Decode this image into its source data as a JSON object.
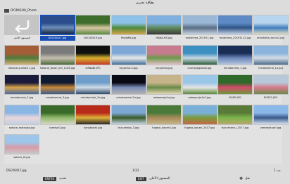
{
  "title": "بطاقة تخزين",
  "path": {
    "label": "DCIM\\100_Photo"
  },
  "up_item": {
    "label": "المستوى الأعلى"
  },
  "files": [
    {
      "label": "DSC00417.jpg",
      "colors": [
        "#2b4d8c",
        "#6e8fb8",
        "#1a2a44"
      ],
      "selected": true
    },
    {
      "label": "DSC00419.jpg",
      "colors": [
        "#3d6d2a",
        "#d8c6a4",
        "#5a8a40"
      ]
    },
    {
      "label": "fliedoffs.jpg",
      "colors": [
        "#8ec1e8",
        "#4f8a3a",
        "#d7a54c"
      ]
    },
    {
      "label": "HANA-HS.jpg",
      "colors": [
        "#7fb0e0",
        "#5f8a5a",
        "#3a3a3a"
      ]
    },
    {
      "label": "enoshima_201911.jpg",
      "colors": [
        "#9ab8d6",
        "#5a6e86",
        "#c9d6e3"
      ]
    },
    {
      "label": "enoshima_20191112.jpg",
      "colors": [
        "#5d89c4",
        "#2f5486",
        "#c4d3e4"
      ]
    },
    {
      "label": "enoshima_touna1.jpg",
      "colors": [
        "#b8d4ee",
        "#3f7fbf",
        "#e6ddc2"
      ]
    },
    {
      "label": "hakone-yumoto 1.jpg",
      "colors": [
        "#a55d38",
        "#4f7a3a",
        "#d9b27a"
      ]
    },
    {
      "label": "hakone_tozan_eki_1108.jpg",
      "colors": [
        "#7a7a7a",
        "#c8c0b0",
        "#4b6a38"
      ]
    },
    {
      "label": "HANABI.JPG",
      "colors": [
        "#101010",
        "#d9b22c",
        "#c23a2a"
      ]
    },
    {
      "label": "fuyyama-3.jpg",
      "colors": [
        "#7fa7d6",
        "#e9e9e9",
        "#3f6f9a"
      ]
    },
    {
      "label": "izuyakina.jpg",
      "colors": [
        "#c77b8e",
        "#6b9a4a",
        "#e3c0c8"
      ]
    },
    {
      "label": "inumayagasaki.jpg",
      "colors": [
        "#3b8fc1",
        "#c9d9e4",
        "#2f5e3b"
      ]
    },
    {
      "label": "minatomirai_1.jpg",
      "colors": [
        "#1a2d55",
        "#6a86b9",
        "#b7c6dd"
      ]
    },
    {
      "label": "minatomirai_1a.jpg",
      "colors": [
        "#8bb4dc",
        "#d4dde6",
        "#4a6a8a"
      ]
    },
    {
      "label": "minatomirai_2.jpg",
      "colors": [
        "#1a1a3a",
        "#d8a54a",
        "#4a6aa0"
      ]
    },
    {
      "label": "minatomirai_3.jpg",
      "colors": [
        "#101a30",
        "#c88a3a",
        "#3a5a8a"
      ]
    },
    {
      "label": "minatomirai_3a.jpg",
      "colors": [
        "#6e9ec9",
        "#d0dbe5",
        "#304a6a"
      ]
    },
    {
      "label": "minatomirai-2a.jpg",
      "colors": [
        "#0a0a14",
        "#7a8cb8",
        "#b2b2b2"
      ]
    },
    {
      "label": "odawarajo1a.jpg",
      "colors": [
        "#c7b38a",
        "#6a8a4a",
        "#e2d6b2"
      ]
    },
    {
      "label": "odawarajo1a2.jpg",
      "colors": [
        "#9ac6e8",
        "#e4e4e4",
        "#5a8a3a"
      ]
    },
    {
      "label": "ROSE.JPG",
      "colors": [
        "#2f6a2a",
        "#d44a6a",
        "#6a9a3a"
      ]
    },
    {
      "label": "ROSE1.JPG",
      "colors": [
        "#b7c8d8",
        "#d87a8a",
        "#6a8a4a"
      ]
    },
    {
      "label": "sakura_matsuda.jpg",
      "colors": [
        "#8ab6e4",
        "#e9d6dc",
        "#c0d0e2"
      ]
    },
    {
      "label": "tomeyo1.jpg",
      "colors": [
        "#3a6a2a",
        "#8fb86a",
        "#d7d7c4"
      ]
    },
    {
      "label": "kanokoichi.jpg",
      "colors": [
        "#b82a1a",
        "#e0b23a",
        "#2a2a2a"
      ]
    },
    {
      "label": "tsurumako_3.jpg",
      "colors": [
        "#7ea8d4",
        "#3a5a2a",
        "#c8d8e8"
      ]
    },
    {
      "label": "fugaso_kouen1.jpg",
      "colors": [
        "#4a7a3a",
        "#a88a5a",
        "#c4b68a"
      ]
    },
    {
      "label": "fugaso_kouen_2017.jpg",
      "colors": [
        "#7ab0d8",
        "#7a9a3a",
        "#c46a4a"
      ]
    },
    {
      "label": "tsurumaruu_2017.jpg",
      "colors": [
        "#5a7a3a",
        "#7ab44a",
        "#b8a86a"
      ]
    },
    {
      "label": "yamanotuari.jpg",
      "colors": [
        "#8ab8e8",
        "#3a5a8a",
        "#d6e2f0"
      ]
    },
    {
      "label": "sakura_fk.jpg",
      "colors": [
        "#9ec6ea",
        "#d89aa8",
        "#c8c8c8"
      ]
    }
  ],
  "footer": {
    "filename": "DSC00417.jpg",
    "position": "1/33",
    "selected": "1 عدد"
  },
  "nav": {
    "enter_key": "ENTER",
    "enter_label": "تحديد",
    "exit_key": "EXIT",
    "exit_label": "المستوى الأعلى",
    "move_label": "نقل"
  }
}
